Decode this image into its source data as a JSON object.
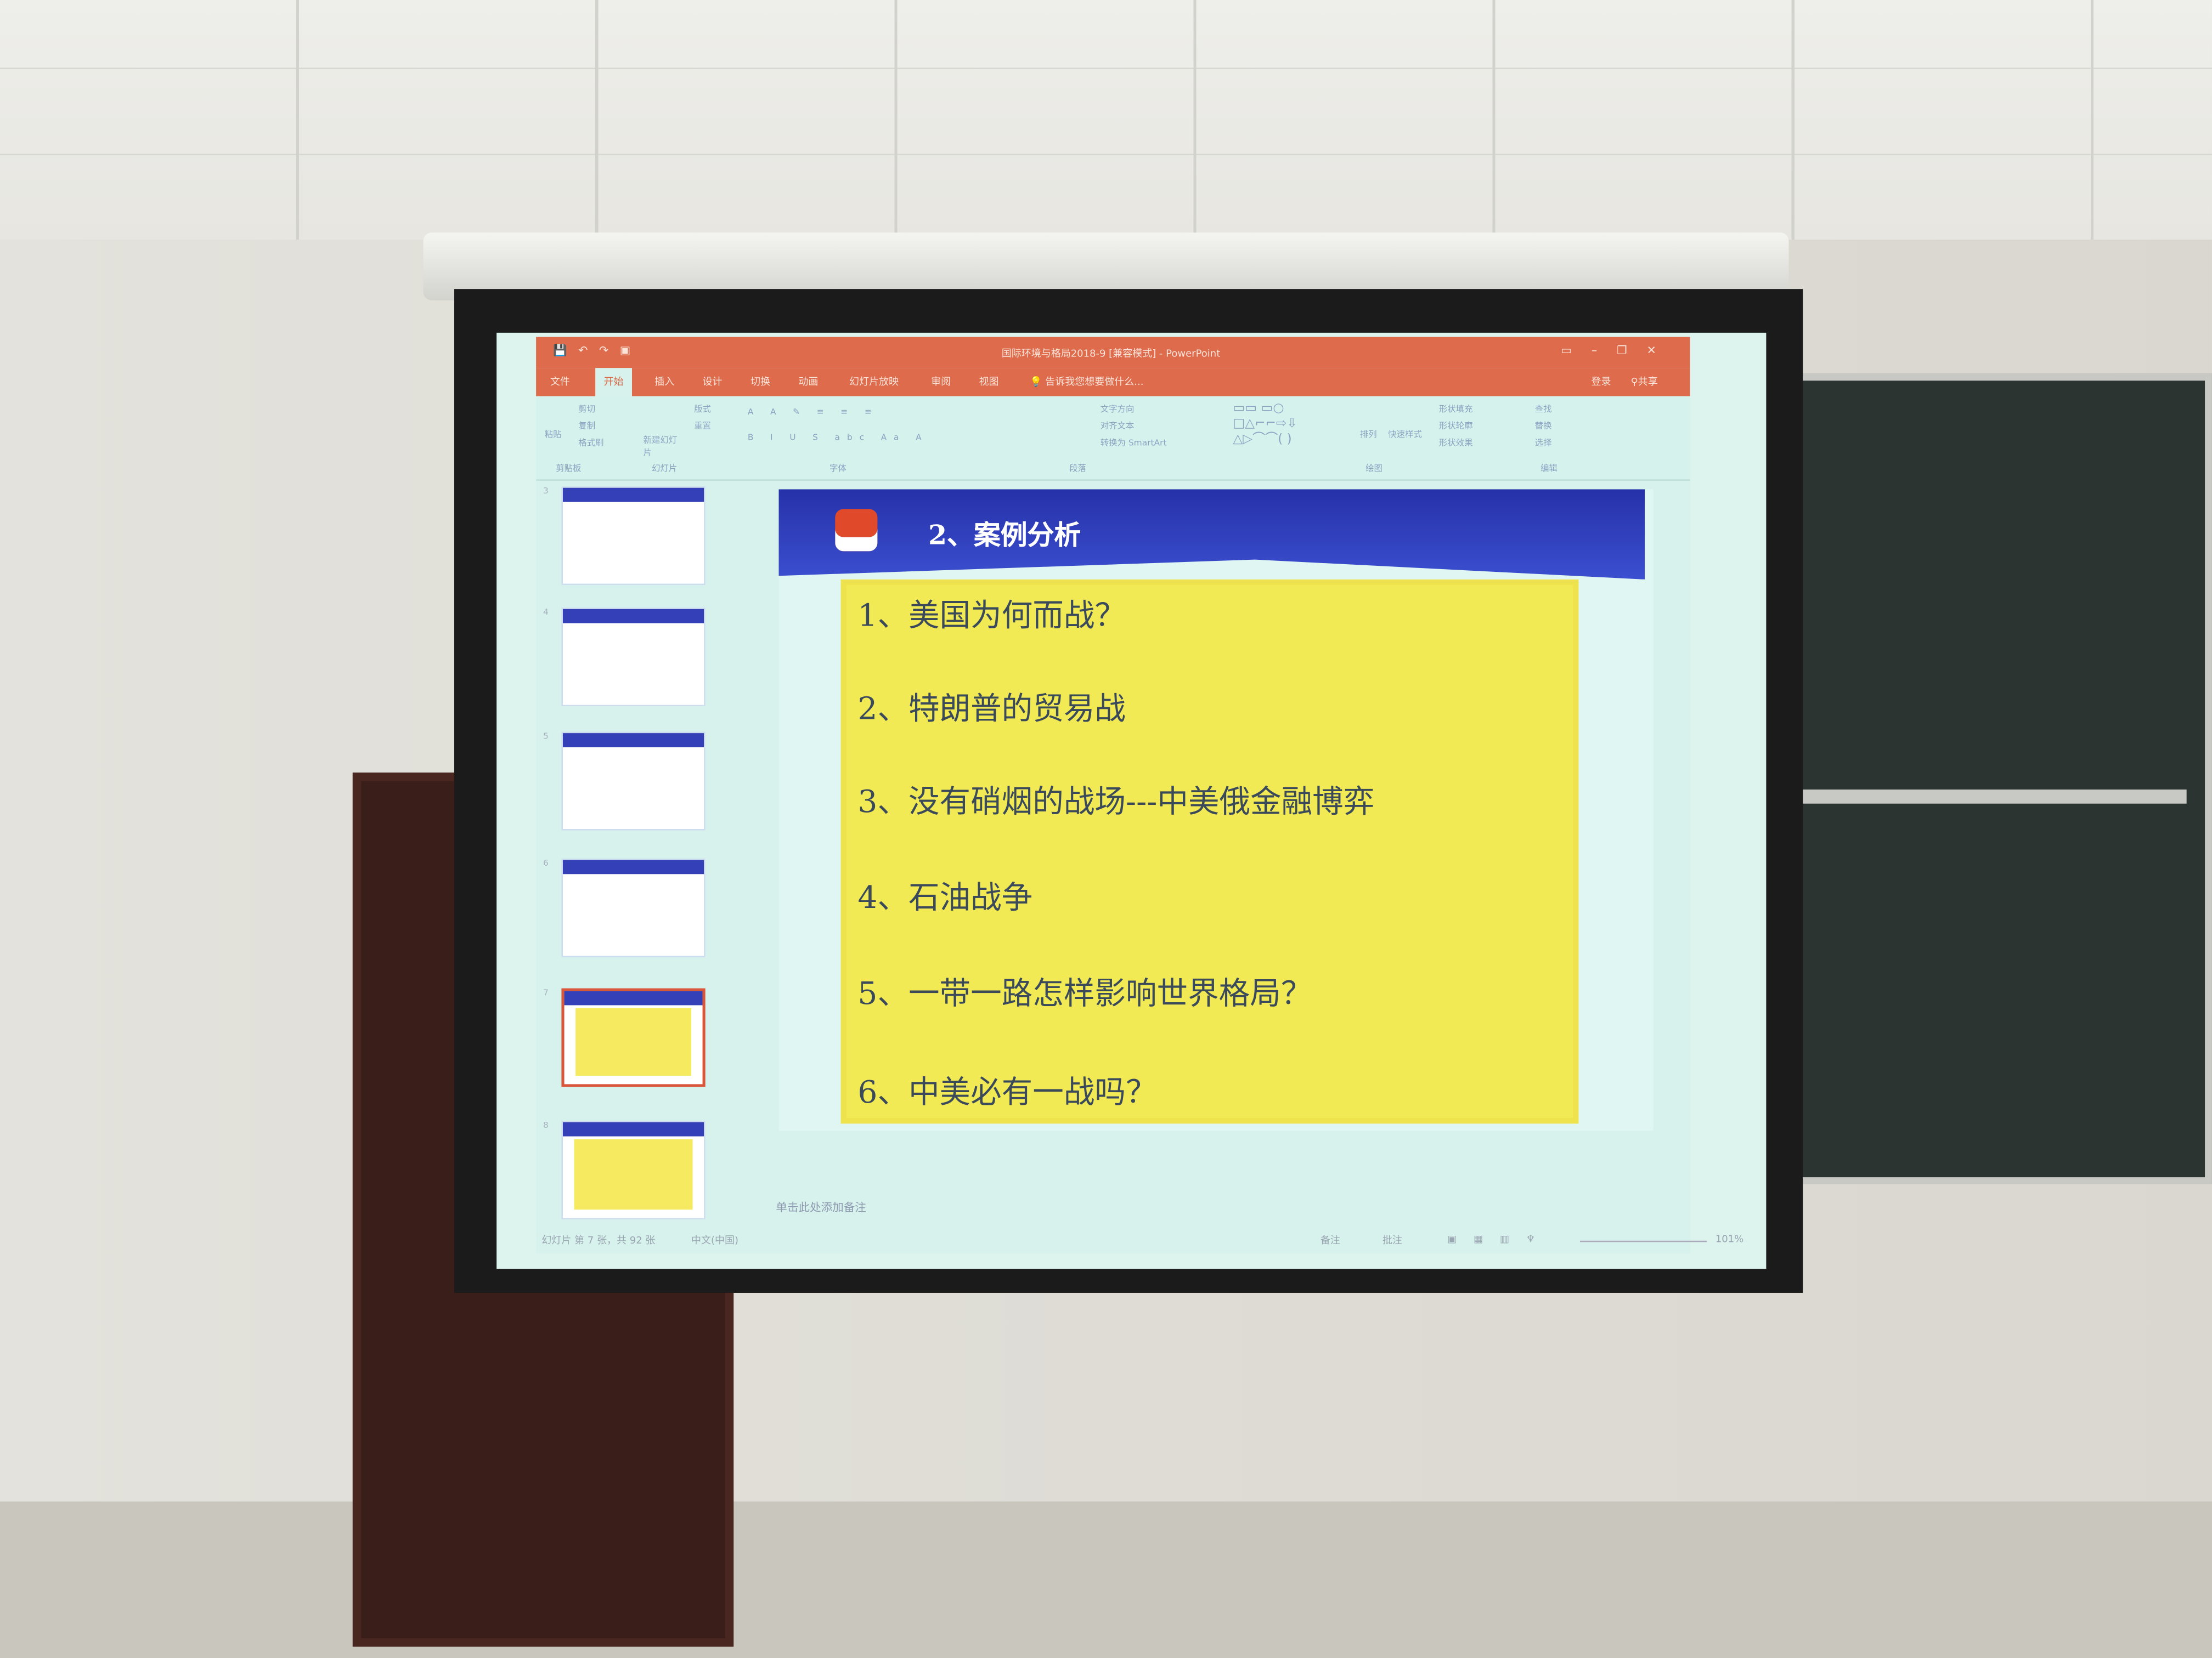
{
  "window": {
    "title": "国际环境与格局2018-9 [兼容模式] - PowerPoint",
    "quick_access": [
      "save-icon",
      "undo-icon",
      "redo-icon",
      "start-icon"
    ],
    "controls": [
      "ribbon-display-icon",
      "minimize-icon",
      "restore-icon",
      "close-icon"
    ]
  },
  "tabs": [
    {
      "label": "文件"
    },
    {
      "label": "开始",
      "active": true
    },
    {
      "label": "插入"
    },
    {
      "label": "设计"
    },
    {
      "label": "切换"
    },
    {
      "label": "动画"
    },
    {
      "label": "幻灯片放映"
    },
    {
      "label": "审阅"
    },
    {
      "label": "视图"
    }
  ],
  "tell_me": "告诉我您想要做什么...",
  "account": {
    "signin": "登录",
    "share": "共享"
  },
  "ribbon": {
    "clipboard": {
      "paste": "粘贴",
      "cut": "剪切",
      "copy": "复制",
      "format_painter": "格式刷",
      "group": "剪贴板"
    },
    "slides": {
      "new_slide": "新建幻灯片",
      "layout": "版式",
      "reset": "重置",
      "group": "幻灯片"
    },
    "font": {
      "group": "字体"
    },
    "paragraph": {
      "text_direction": "文字方向",
      "align_text": "对齐文本",
      "smartart": "转换为 SmartArt",
      "group": "段落"
    },
    "drawing": {
      "arrange": "排列",
      "quick_styles": "快速样式",
      "shape_fill": "形状填充",
      "shape_outline": "形状轮廓",
      "shape_effects": "形状效果",
      "group": "绘图"
    },
    "editing": {
      "find": "查找",
      "replace": "替换",
      "select": "选择",
      "group": "编辑"
    }
  },
  "thumbnails": [
    {
      "number": "3"
    },
    {
      "number": "4"
    },
    {
      "number": "5"
    },
    {
      "number": "6"
    },
    {
      "number": "7",
      "selected": true
    },
    {
      "number": "8"
    }
  ],
  "slide": {
    "title": "2、案例分析",
    "items": [
      "1、美国为何而战？",
      "2、特朗普的贸易战",
      "3、没有硝烟的战场---中美俄金融博弈",
      "4、石油战争",
      "5、一带一路怎样影响世界格局？",
      "6、中美必有一战吗？"
    ],
    "colors": {
      "header": "#2a36b0",
      "box": "#f2ea55"
    }
  },
  "notes_placeholder": "单击此处添加备注",
  "status": {
    "slide_info": "幻灯片 第 7 张，共 92 张",
    "language": "中文(中国)",
    "notes": "备注",
    "comments": "批注",
    "zoom": "101%"
  },
  "accent": "#de6c4c"
}
